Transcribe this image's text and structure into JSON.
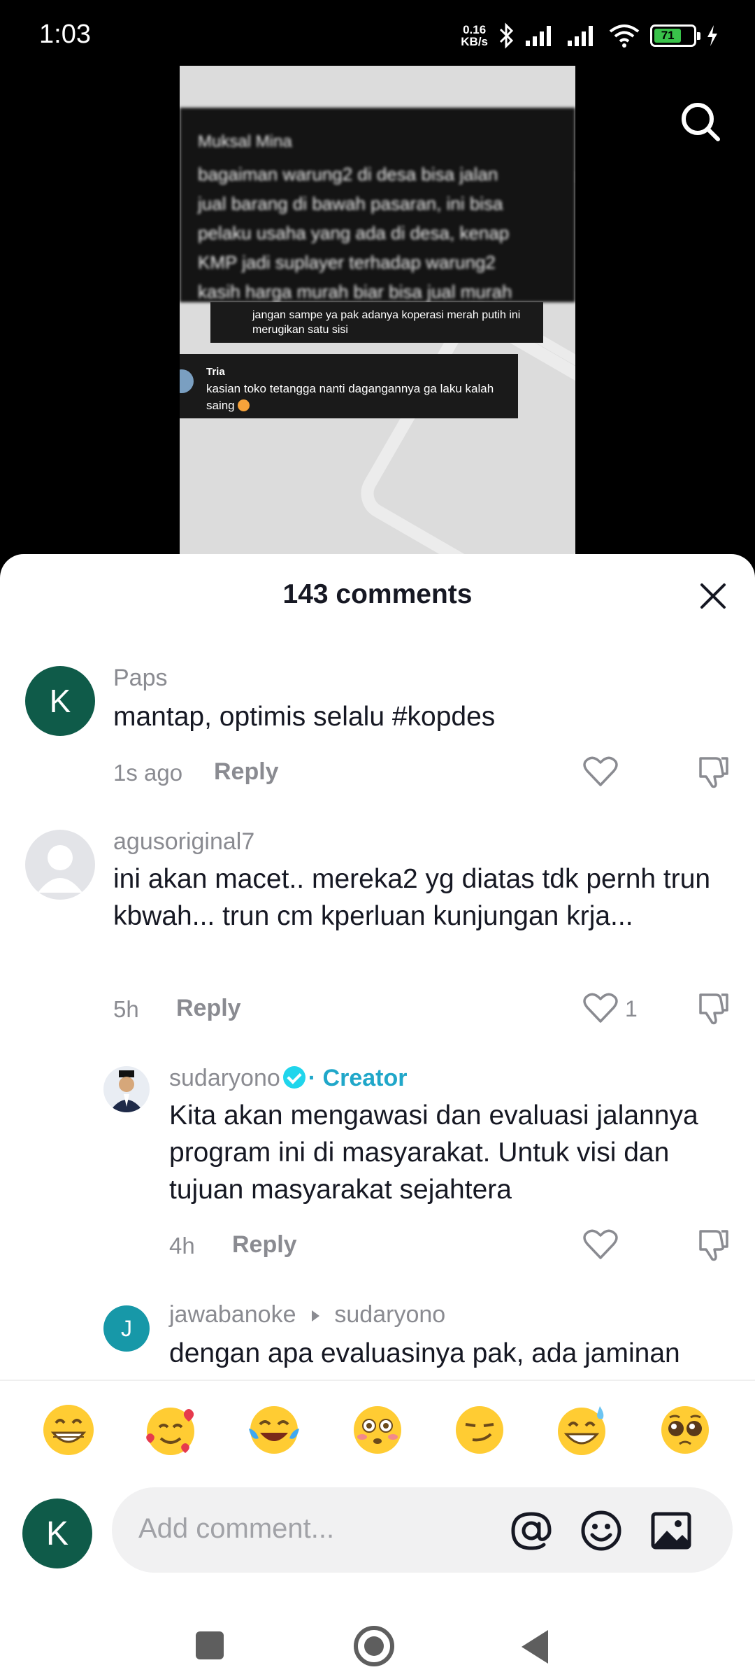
{
  "status_bar": {
    "time": "1:03",
    "net_speed_value": "0.16",
    "net_speed_unit": "KB/s",
    "battery": "71"
  },
  "video": {
    "blurred_name": "Muksal Mina",
    "blurred_lines": [
      "bagaiman warung2 di desa bisa jalan",
      "jual barang di bawah pasaran, ini bisa",
      "pelaku usaha yang ada di desa, kenap",
      "KMP jadi suplayer terhadap warung2",
      "kasih harga murah biar bisa jual murah"
    ],
    "card1_text": "jangan sampe ya pak adanya koperasi merah putih ini merugikan satu sisi",
    "card2_name": "Tria",
    "card2_text": "kasian toko tetangga nanti dagangannya ga laku kalah saing"
  },
  "sheet": {
    "title": "143 comments"
  },
  "comments": [
    {
      "username": "Paps",
      "avatar_letter": "K",
      "text": "mantap, optimis selalu #kopdes",
      "time": "1s ago",
      "reply_label": "Reply",
      "likes": ""
    },
    {
      "username": "agusoriginal7",
      "text": "ini akan macet.. mereka2 yg diatas tdk pernh trun kbwah... trun cm kperluan kunjungan krja...",
      "time": "5h",
      "reply_label": "Reply",
      "likes": "1"
    },
    {
      "username": "sudaryono",
      "badge": "· Creator",
      "text": "Kita akan mengawasi dan evaluasi jalannya program ini di masyarakat. Untuk visi dan tujuan masyarakat sejahtera",
      "time": "4h",
      "reply_label": "Reply",
      "likes": ""
    },
    {
      "username": "jawabanoke",
      "reply_to": "sudaryono",
      "avatar_letter": "J",
      "text": "dengan apa evaluasinya pak, ada jaminan"
    }
  ],
  "emoji_bar": {
    "items": [
      "grinning-face",
      "smiling-face-with-hearts",
      "face-with-tears-of-joy",
      "flushed-face",
      "smirking-face",
      "grinning-face-with-sweat",
      "pleading-face"
    ]
  },
  "composer": {
    "avatar_letter": "K",
    "placeholder": "Add comment..."
  },
  "colors": {
    "accent_creator": "#20a7c9",
    "avatar_green": "#0f5b49",
    "avatar_teal": "#1798a8"
  }
}
